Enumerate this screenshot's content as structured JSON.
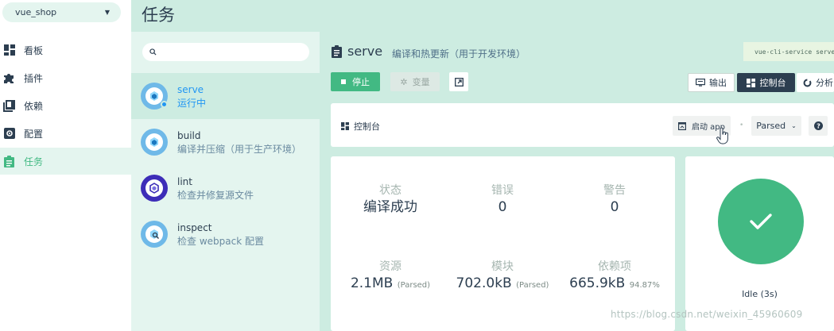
{
  "project": {
    "name": "vue_shop"
  },
  "nav": [
    {
      "label": "看板",
      "icon": "dashboard-icon"
    },
    {
      "label": "插件",
      "icon": "puzzle-icon"
    },
    {
      "label": "依赖",
      "icon": "library-icon"
    },
    {
      "label": "配置",
      "icon": "settings-icon"
    },
    {
      "label": "任务",
      "icon": "assignment-icon",
      "active": true
    }
  ],
  "page": {
    "title": "任务"
  },
  "search": {
    "placeholder": ""
  },
  "tasks": [
    {
      "name": "serve",
      "desc": "运行中",
      "active": true,
      "running": true
    },
    {
      "name": "build",
      "desc": "编译并压缩（用于生产环境）"
    },
    {
      "name": "lint",
      "desc": "检查并修复源文件"
    },
    {
      "name": "inspect",
      "desc": "检查 webpack 配置"
    }
  ],
  "task_header": {
    "name": "serve",
    "desc": "编译和热更新（用于开发环境）",
    "command": "vue-cli-service serve"
  },
  "toolbar": {
    "stop": "停止",
    "variables": "变量",
    "output": "输出",
    "console": "控制台",
    "analyze": "分析"
  },
  "panel": {
    "title": "控制台",
    "launch": "启动 app",
    "mode": "Parsed"
  },
  "stats": {
    "status": {
      "label": "状态",
      "value": "编译成功"
    },
    "errors": {
      "label": "错误",
      "value": "0"
    },
    "warnings": {
      "label": "警告",
      "value": "0"
    },
    "assets": {
      "label": "资源",
      "value": "2.1MB",
      "note": "(Parsed)"
    },
    "modules": {
      "label": "模块",
      "value": "702.0kB",
      "note": "(Parsed)"
    },
    "deps": {
      "label": "依赖项",
      "value": "665.9kB",
      "note": "94.87%"
    }
  },
  "idle": {
    "label": "Idle (3s)"
  },
  "watermark": "https://blog.csdn.net/weixin_45960609",
  "colors": {
    "accent": "#42b983",
    "dark": "#2c3e50",
    "running": "#2196f3",
    "lint": "#3d2db8"
  }
}
